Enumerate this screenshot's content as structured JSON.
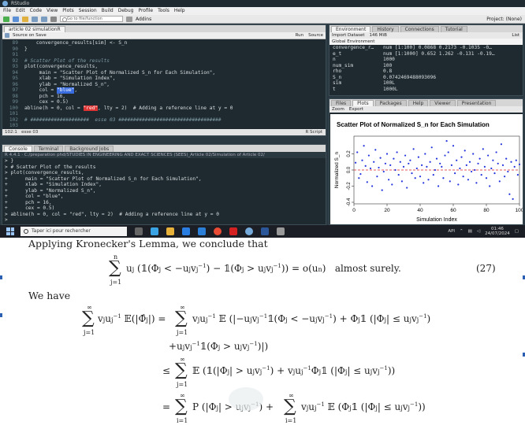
{
  "window": {
    "title": "RStudio"
  },
  "menu": [
    "File",
    "Edit",
    "Code",
    "View",
    "Plots",
    "Session",
    "Build",
    "Debug",
    "Profile",
    "Tools",
    "Help"
  ],
  "toolbar": {
    "goto_placeholder": "Go to file/function",
    "addins": "Addins",
    "project": "Project: (None)"
  },
  "editor": {
    "tab": "article 02 simulationR",
    "source_on_save": "Source on Save",
    "run": "Run",
    "source": "Source",
    "lines": [
      {
        "n": "89",
        "text": "    convergence_results[sim] <- S_n"
      },
      {
        "n": "90",
        "text": "}"
      },
      {
        "n": "91",
        "text": ""
      },
      {
        "n": "92",
        "text": "# Scatter Plot of the results"
      },
      {
        "n": "93",
        "text": "plot(convergence_results,"
      },
      {
        "n": "94",
        "text": "     main = \"Scatter Plot of Normalized S_n for Each Simulation\","
      },
      {
        "n": "95",
        "text": "     xlab = \"Simulation Index\","
      },
      {
        "n": "96",
        "text": "     ylab = \"Normalized S_n\","
      },
      {
        "n": "97",
        "text": "     col = "
      },
      {
        "n": "98",
        "text": "     pch = 16,"
      },
      {
        "n": "99",
        "text": "     cex = 0.5)"
      },
      {
        "n": "100",
        "text": "abline(h = 0, col = "
      },
      {
        "n": "101",
        "text": ""
      },
      {
        "n": "102",
        "text": "# ####################  esse 03 ###################################"
      },
      {
        "n": "103",
        "text": ""
      },
      {
        "n": "104",
        "text": "# Simulation of AR(1) process and convergence for different n"
      },
      {
        "n": "105",
        "text": "set.seed(123)  # For reproducibility"
      },
      {
        "n": "106",
        "text": ""
      }
    ],
    "line97_value": "\"blue\"",
    "line97_tail": ",",
    "line100_value": "\"red\"",
    "line100_tail": ", lty = 2)  # Adding a reference line at y = 0",
    "status_pos": "102:1",
    "status_item": "esse 03",
    "status_lang": "R Script"
  },
  "console": {
    "tabs": [
      "Console",
      "Terminal",
      "Background Jobs"
    ],
    "path": "R 4.4.1 · C:/preparation phd/STUDIES IN ENGINEERING AND EXACT SCIENCES (SEES)_Article 02/Simulation of Article 02/",
    "lines": [
      "> }",
      "> # Scatter Plot of the results",
      "> plot(convergence_results,",
      "+      main = \"Scatter Plot of Normalized S_n for Each Simulation\",",
      "+      xlab = \"Simulation Index\",",
      "+      ylab = \"Normalized S_n\",",
      "+      col = \"blue\",",
      "+      pch = 16,",
      "+      cex = 0.5)",
      "> abline(h = 0, col = \"red\", lty = 2)  # Adding a reference line at y = 0",
      ">"
    ]
  },
  "environment": {
    "tabs": [
      "Environment",
      "History",
      "Connections",
      "Tutorial"
    ],
    "import": "Import Dataset",
    "memory": "146 MiB",
    "list": "List",
    "scope": "Global Environment",
    "rows": [
      {
        "name": "convergence_r…",
        "value": "num [1:100] 0.0868 0.2173 -0.1035 -0…"
      },
      {
        "name": "e_t",
        "value": "num [1:1000] 0.652 1.262 -0.131 -0.19…"
      },
      {
        "name": "n",
        "value": "1000"
      },
      {
        "name": "num_sim",
        "value": "100"
      },
      {
        "name": "rho",
        "value": "0.8"
      },
      {
        "name": "S_n",
        "value": "0.0742469488093096"
      },
      {
        "name": "sim",
        "value": "100L"
      },
      {
        "name": "t",
        "value": "1000L"
      }
    ]
  },
  "plots_pane": {
    "tabs": [
      "Files",
      "Plots",
      "Packages",
      "Help",
      "Viewer",
      "Presentation"
    ],
    "zoom": "Zoom",
    "export": "Export"
  },
  "chart_data": {
    "type": "scatter",
    "title": "Scatter Plot of Normalized S_n for Each Simulation",
    "xlabel": "Simulation Index",
    "ylabel": "Normalized S_n",
    "xlim": [
      0,
      100
    ],
    "ylim": [
      -0.4,
      0.4
    ],
    "xticks": [
      0,
      20,
      40,
      60,
      80,
      100
    ],
    "yticks": [
      -0.4,
      -0.2,
      0.0,
      0.2
    ],
    "point_color": "#2233dd",
    "refline": {
      "y": 0,
      "color": "#dd2222",
      "style": "dashed"
    },
    "x": [
      1,
      2,
      3,
      4,
      5,
      6,
      7,
      8,
      9,
      10,
      11,
      12,
      13,
      14,
      15,
      16,
      17,
      18,
      19,
      20,
      21,
      22,
      23,
      24,
      25,
      26,
      27,
      28,
      29,
      30,
      31,
      32,
      33,
      34,
      35,
      36,
      37,
      38,
      39,
      40,
      41,
      42,
      43,
      44,
      45,
      46,
      47,
      48,
      49,
      50,
      51,
      52,
      53,
      54,
      55,
      56,
      57,
      58,
      59,
      60,
      61,
      62,
      63,
      64,
      65,
      66,
      67,
      68,
      69,
      70,
      71,
      72,
      73,
      74,
      75,
      76,
      77,
      78,
      79,
      80,
      81,
      82,
      83,
      84,
      85,
      86,
      87,
      88,
      89,
      90,
      91,
      92,
      93,
      94,
      95,
      96,
      97,
      98,
      99,
      100
    ],
    "y": [
      0.09,
      0.22,
      -0.1,
      -0.05,
      0.12,
      0.3,
      0.05,
      -0.15,
      0.18,
      0.02,
      -0.2,
      0.1,
      0.25,
      -0.08,
      0.03,
      0.15,
      -0.25,
      -0.02,
      0.08,
      0.2,
      -0.12,
      0.06,
      -0.18,
      0.14,
      0.0,
      0.22,
      -0.06,
      0.1,
      -0.14,
      0.04,
      0.18,
      -0.22,
      0.08,
      0.12,
      -0.04,
      0.26,
      -0.1,
      0.02,
      0.16,
      -0.08,
      0.06,
      -0.16,
      0.2,
      0.04,
      -0.12,
      0.1,
      0.28,
      -0.06,
      0.0,
      0.14,
      -0.2,
      0.08,
      0.04,
      -0.1,
      0.18,
      0.36,
      0.22,
      -0.14,
      0.06,
      0.3,
      -0.04,
      0.12,
      -0.18,
      0.02,
      0.16,
      -0.08,
      0.24,
      0.06,
      -0.12,
      0.1,
      -0.02,
      0.2,
      0.0,
      -0.16,
      0.08,
      0.14,
      -0.06,
      0.26,
      0.04,
      -0.1,
      0.18,
      -0.2,
      0.02,
      0.12,
      -0.04,
      0.22,
      0.08,
      -0.14,
      0.32,
      0.06,
      -0.08,
      0.14,
      -0.02,
      -0.3,
      0.1,
      -0.36,
      0.04,
      0.12,
      -0.06,
      0.07
    ]
  },
  "taskbar": {
    "search": "Taper ici pour rechercher",
    "api": "API",
    "time": "01:46",
    "date": "24/07/2024"
  },
  "document": {
    "line1": "Applying Kronecker's Lemma, we conclude that",
    "eq27": "∑ u_j (𝟙(Φ_j < −u_j v_j^{−1}) − 𝟙(Φ_j > u_j v_j^{−1})) = o(u_n)  almost surely.",
    "eq27_no": "(27)",
    "we_have": "We have",
    "row1_lhs": "∑ v_j u_j⁻¹ 𝔼(|Φ̂_j|) = ∑ v_j u_j⁻¹ 𝔼 ( |−u_j v_j⁻¹ 𝟙(Φ_j < −u_j v_j⁻¹) + Φ_j 𝟙 ( |Φ_j| ≤ u_j v_j⁻¹ )",
    "row2": "+ u_j v_j⁻¹ 𝟙(Φ_j > u_j v_j⁻¹)| )",
    "row3": "≤ ∑ 𝔼 ( 𝟙(|Φ_j| > u_j v_j⁻¹) + v_j u_j⁻¹ Φ_j 𝟙 ( |Φ_j| ≤ u_j v_j⁻¹ ) )",
    "row4": "= ∑ P ( |Φ_j| > u_j v_j⁻¹ ) + ∑ v_j u_j⁻¹ 𝔼 ( Φ_j 𝟙 ( |Φ_j| ≤ u_j v_j⁻¹ ) )"
  }
}
